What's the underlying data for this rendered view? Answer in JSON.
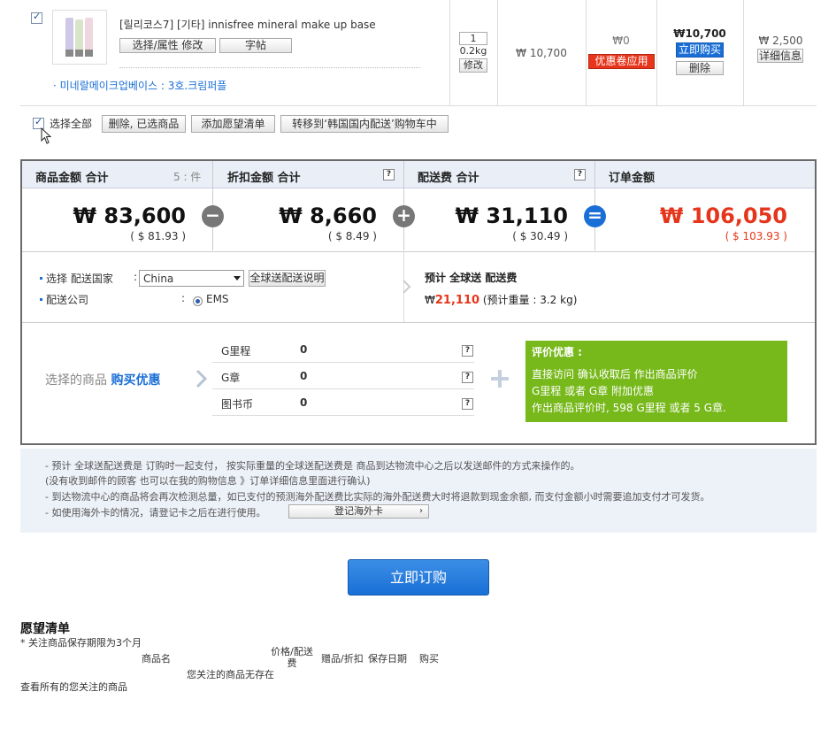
{
  "item": {
    "name": "[릴리코스7] [기타] innisfree mineral make up base",
    "option_btn": "选择/属性 修改",
    "post_btn": "字帖",
    "option_text": "· 미네랄메이크업베이스 : 3호.크림퍼플",
    "qty": "1",
    "weight": "0.2kg",
    "modify_btn": "修改",
    "price": "₩ 10,700",
    "discount": "₩0",
    "coupon_btn": "优惠卷应用",
    "total": "₩10,700",
    "buy_now_btn": "立即购买",
    "delete_btn": "删除",
    "shipping": "₩ 2,500",
    "detail_btn": "详细信息"
  },
  "actions": {
    "select_all": "选择全部",
    "delete_selected": "删除, 已选商品",
    "add_wishlist": "添加愿望清单",
    "move_domestic": "转移到‘韩国国内配送’购物车中"
  },
  "summary": {
    "goods_label": "商品金额 合计",
    "goods_count": "5 : 件",
    "goods_amount": "₩ 83,600",
    "goods_usd": "( $ 81.93 )",
    "discount_label": "折扣金额 合计",
    "discount_amount": "₩ 8,660",
    "discount_usd": "( $ 8.49 )",
    "shipping_label": "配送费 合计",
    "shipping_amount": "₩ 31,110",
    "shipping_usd": "( $ 30.49 )",
    "order_label": "订单金额",
    "order_amount": "₩ 106,050",
    "order_usd": "( $ 103.93 )",
    "q": "?",
    "minus": "−",
    "plus": "+",
    "equals": "="
  },
  "delivery": {
    "country_label": "选择 配送国家",
    "country_value": "China",
    "guide_btn": "全球送配送说明",
    "company_label": "配送公司",
    "company_value": "EMS",
    "colon": ":",
    "est_title": "预计 全球送 配送费",
    "est_prefix": "₩",
    "est_amount": "21,110",
    "est_weight": "(预计重量 : 3.2 kg)"
  },
  "benefit": {
    "label_plain": "选择的商品",
    "label_bold": "购买优惠",
    "rows": [
      {
        "label": "G里程",
        "value": "0"
      },
      {
        "label": "G章",
        "value": "0"
      },
      {
        "label": "图书币",
        "value": "0"
      }
    ],
    "review_title": "评价优惠 :",
    "review_line1": "直接访问 确认收取后 作出商品评价",
    "review_line2": "G里程 或者 G章 附加优惠",
    "review_line3": "作出商品评价时, 598 G里程 或者 5 G章."
  },
  "notes": {
    "line1": "- 预计 全球送配送费是 订购时一起支付， 按实际重量的全球送配送费是 商品到达物流中心之后以发送邮件的方式来操作的。",
    "line2": "(没有收到邮件的顾客 也可以在我的购物信息 》订单详细信息里面进行确认)",
    "line3": "- 到达物流中心的商品将会再次检测总量，如已支付的预测海外配送费比实际的海外配送费大时将退款到现金余额, 而支付金额小时需要追加支付才可发货。",
    "line4": "- 如使用海外卡的情况，请登记卡之后在进行使用。",
    "card_btn": "登记海外卡"
  },
  "order_btn": "立即订购",
  "wishlist": {
    "title": "愿望清单",
    "note": "* 关注商品保存期限为3个月",
    "col_name": "商品名",
    "col_price_line1": "价格/配送",
    "col_price_line2": "费",
    "col_gift": "赠品/折扣",
    "col_date": "保存日期",
    "col_buy": "购买",
    "empty": "您关注的商品无存在",
    "view_all": "查看所有的您关注的商品"
  }
}
